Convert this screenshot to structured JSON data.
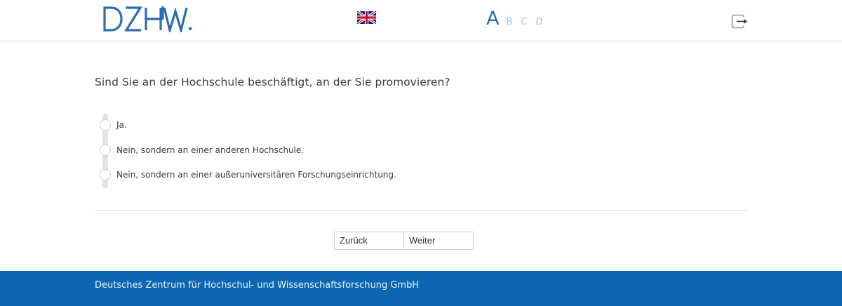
{
  "header": {
    "logo_text": "DZHW.",
    "language_flag": "uk-flag-icon",
    "font_size_options": [
      "A",
      "B",
      "C",
      "D"
    ],
    "logout_icon": "logout-icon"
  },
  "question": {
    "text": "Sind Sie an der Hochschule beschäftigt, an der Sie promovieren?",
    "options": [
      {
        "label": "Ja.",
        "selected": false
      },
      {
        "label": "Nein, sondern an einer anderen Hochschule.",
        "selected": false
      },
      {
        "label": "Nein, sondern an einer außeruniversitären Forschungseinrichtung.",
        "selected": false
      }
    ]
  },
  "navigation": {
    "back_label": "Zurück",
    "next_label": "Weiter"
  },
  "footer": {
    "text": "Deutsches Zentrum für Hochschul- und Wissenschaftsforschung GmbH"
  },
  "colors": {
    "brand_blue": "#0b67b1",
    "logo_blue": "#2b6cb3",
    "font_size_active": "#1f6fb5",
    "font_size_inactive": "#9cc6ea"
  }
}
